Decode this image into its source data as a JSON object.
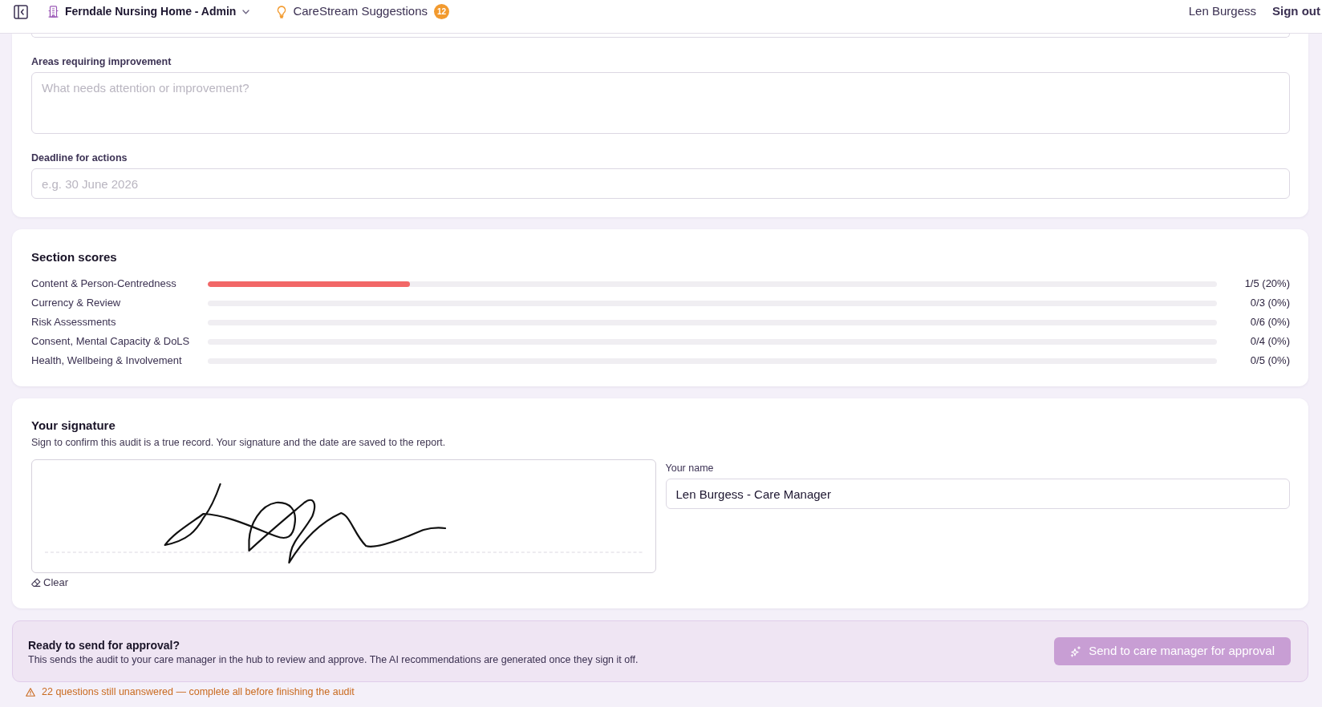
{
  "navbar": {
    "site": {
      "label": "Ferndale Nursing Home - Admin"
    },
    "suggestions": {
      "label": "CareStream Suggestions",
      "count": "12"
    },
    "user": "Len Burgess",
    "sign_out": "Sign out"
  },
  "details_form": {
    "fields": [
      {
        "kind": "textarea",
        "label": "Areas requiring improvement",
        "placeholder": "What needs attention or improvement?"
      },
      {
        "kind": "input",
        "label": "Deadline for actions",
        "placeholder": "e.g. 30 June 2026"
      }
    ]
  },
  "section_scores": {
    "title": "Section scores",
    "rows": [
      {
        "name": "Content & Person-Centredness",
        "level": 0.2,
        "reading": "1/5 (20%)"
      },
      {
        "name": "Currency & Review",
        "reading": "0/3 (0%)"
      },
      {
        "name": "Risk Assessments",
        "reading": "0/6 (0%)"
      },
      {
        "name": "Consent, Mental Capacity & DoLS",
        "reading": "0/4 (0%)"
      },
      {
        "name": "Health, Wellbeing & Involvement",
        "reading": "0/5 (0%)"
      }
    ]
  },
  "signature": {
    "title": "Your signature",
    "description": "Sign to confirm this audit is a true record. Your signature and the date are saved to the report.",
    "signed": true,
    "clear": "Clear",
    "name_label": "Your name",
    "name_value": "Len Burgess - Care Manager"
  },
  "approval": {
    "title": "Ready to send for approval?",
    "description": "This sends the audit to your care manager in the hub to review and approve. The AI recommendations are generated once they sign it off.",
    "button": {
      "label": "Send to care manager for approval",
      "disabled": true
    }
  },
  "warning": "22 questions still unanswered — complete all before finishing the audit"
}
